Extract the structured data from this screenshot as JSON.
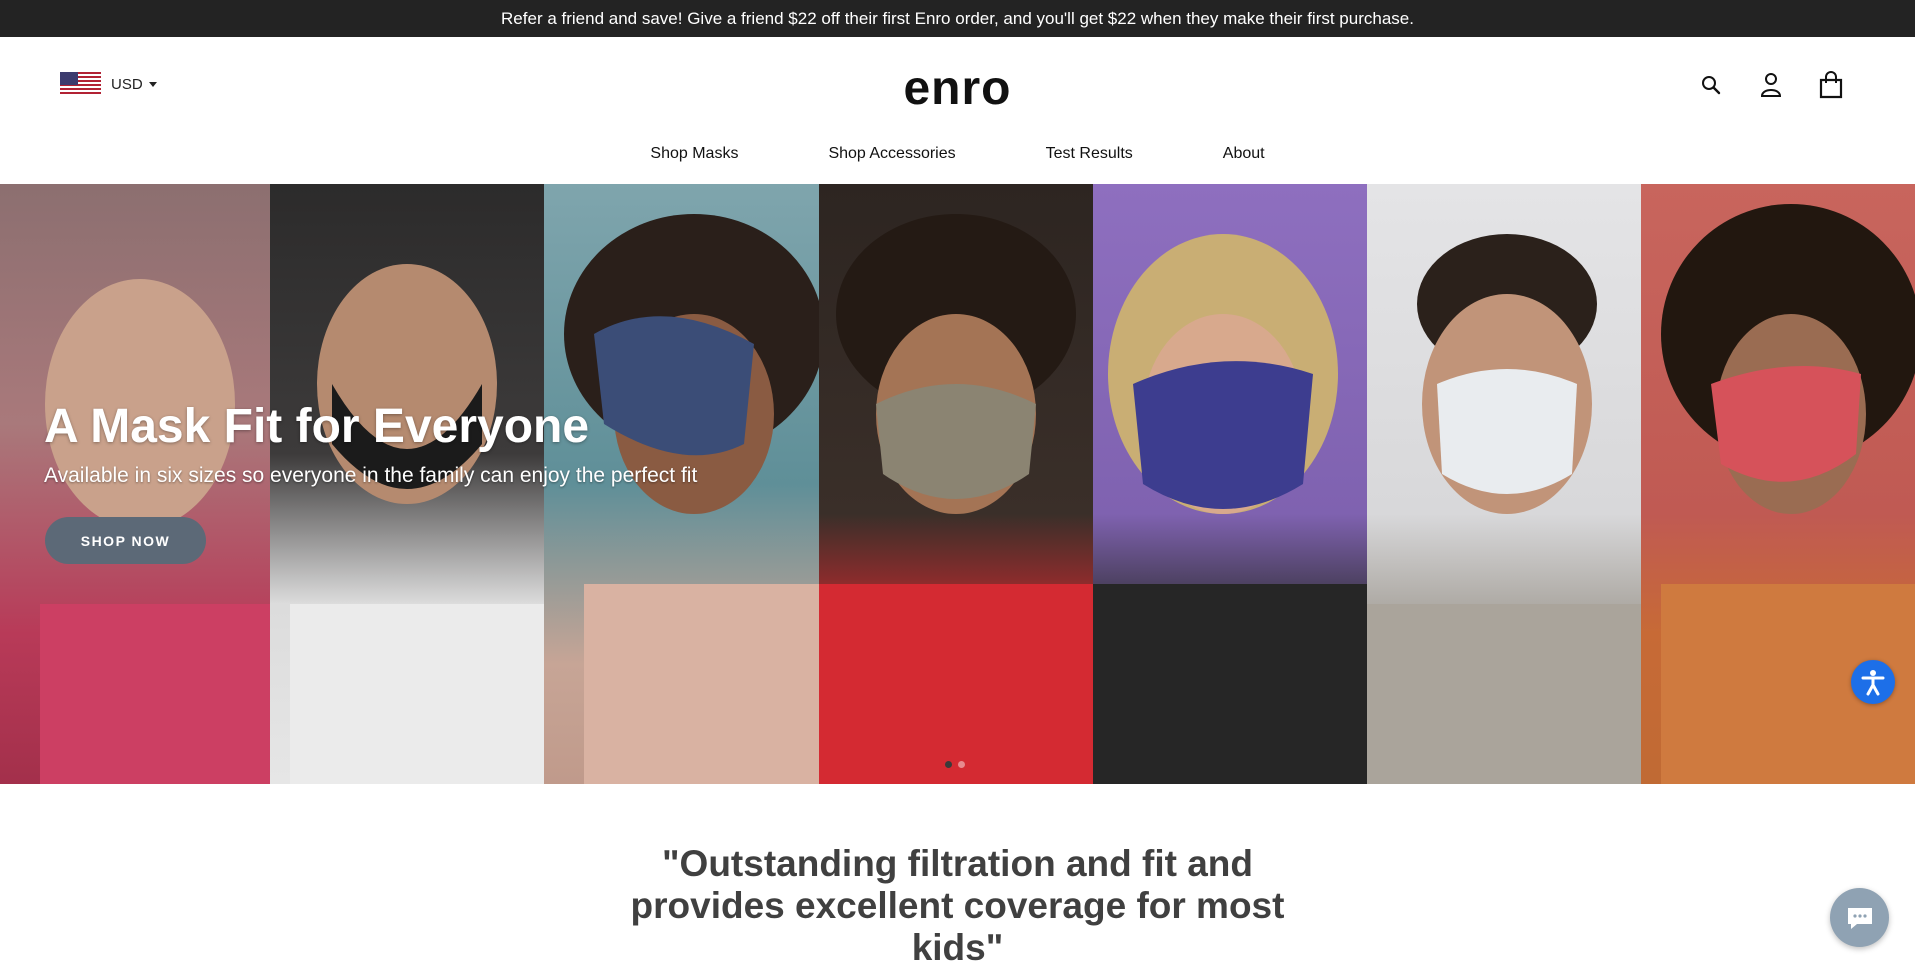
{
  "announcement": "Refer a friend and save! Give a friend $22 off their first Enro order, and you'll get $22 when they make their first purchase.",
  "header": {
    "currency": "USD",
    "logo": "enro",
    "icons": [
      "search-icon",
      "account-icon",
      "cart-icon"
    ]
  },
  "nav": {
    "items": [
      "Shop Masks",
      "Shop Accessories",
      "Test Results",
      "About"
    ]
  },
  "hero": {
    "title": "A Mask Fit for Everyone",
    "subtitle": "Available in six sizes so everyone in the family can enjoy the perfect fit",
    "cta": "SHOP NOW",
    "slide_count": 2,
    "active_slide": 1
  },
  "quote": {
    "lines": [
      "\"Outstanding filtration and fit and",
      "provides excellent coverage for most",
      "kids\""
    ]
  },
  "colors": {
    "announcement_bg": "#232323",
    "cta_bg": "#5c6977",
    "accessibility": "#1d6fe8",
    "chat": "#8fa2b3",
    "quote_text": "#404040"
  }
}
